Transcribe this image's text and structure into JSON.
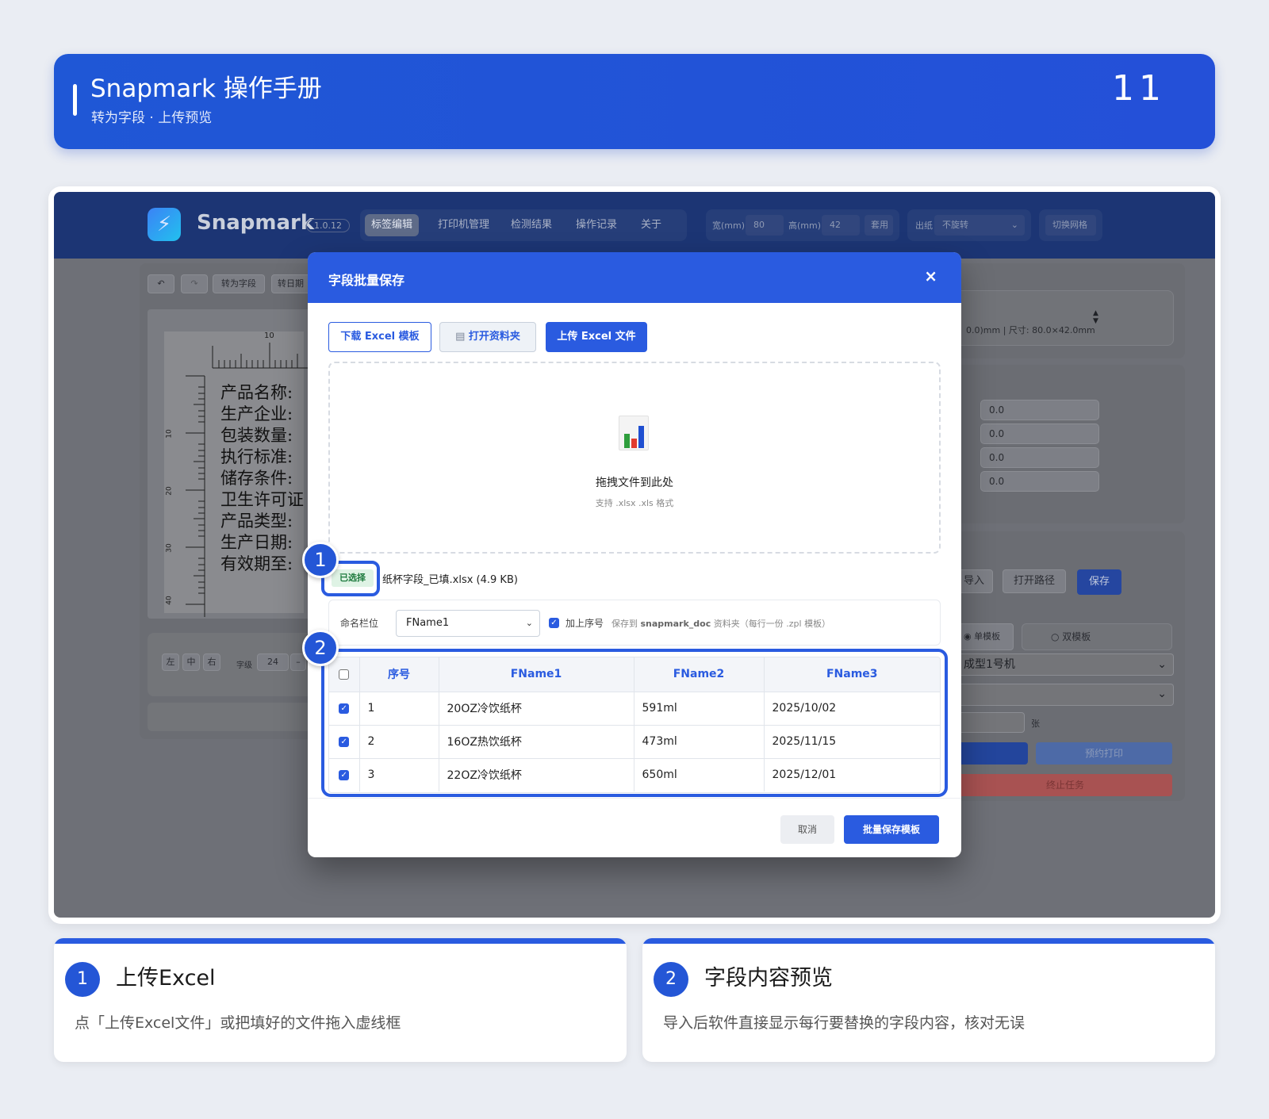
{
  "header": {
    "title": "Snapmark 操作手册",
    "subtitle": "转为字段 · 上传预览",
    "page_number": "11"
  },
  "app": {
    "brand": "Snapmark",
    "version": "1.0.12",
    "nav": [
      "标签编辑",
      "打印机管理",
      "检测结果",
      "操作记录",
      "关于"
    ],
    "width_label": "宽(mm)",
    "width_value": "80",
    "height_label": "高(mm)",
    "height_value": "42",
    "apply_label": "套用",
    "paper_label": "出纸",
    "paper_value": "不旋转",
    "grid_label": "切换网格",
    "toolbar": {
      "to_field": "转为字段",
      "to_date": "转日期"
    },
    "ruler_top": "10",
    "ruler_left": [
      "10",
      "20",
      "30",
      "40"
    ],
    "label_lines": [
      "产品名称:",
      "生产企业:",
      "包装数量:",
      "执行标准:",
      "储存条件:",
      "卫生许可证",
      "产品类型:",
      "生产日期:",
      "有效期至:"
    ],
    "align": [
      "左",
      "中",
      "右"
    ],
    "font_size_label": "字级",
    "font_size_value": "24",
    "minus_label": "–",
    "right_info": "0.0)mm | 尺寸: 80.0×42.0mm",
    "offset_values": [
      "0.0",
      "0.0",
      "0.0",
      "0.0"
    ],
    "import_label": "导入",
    "open_path": "打开路径",
    "save": "保存",
    "single_template": "单模板",
    "double_template": "双模板",
    "printer_select": "成型1号机",
    "sheet_unit": "张",
    "schedule_print": "预约打印",
    "stop_task": "终止任务"
  },
  "modal": {
    "title": "字段批量保存",
    "close": "×",
    "download_btn": "下载 Excel 模板",
    "open_folder_btn": "打开资料夹",
    "upload_btn": "上传 Excel 文件",
    "drop_text": "拖拽文件到此处",
    "drop_hint": "支持 .xlsx .xls 格式",
    "selected_badge": "已选择",
    "file_name": "纸杯字段_已填.xlsx (4.9 KB)",
    "name_field_label": "命名栏位",
    "name_field_value": "FName1",
    "add_seq_label": "加上序号",
    "save_hint_prefix": "保存到",
    "save_hint_folder": "snapmark_doc",
    "save_hint_suffix": "资料夹（每行一份 .zpl 模板）",
    "columns": [
      "序号",
      "FName1",
      "FName2",
      "FName3"
    ],
    "rows": [
      {
        "seq": "1",
        "f1": "20OZ冷饮纸杯",
        "f2": "591ml",
        "f3": "2025/10/02"
      },
      {
        "seq": "2",
        "f1": "16OZ热饮纸杯",
        "f2": "473ml",
        "f3": "2025/11/15"
      },
      {
        "seq": "3",
        "f1": "22OZ冷饮纸杯",
        "f2": "650ml",
        "f3": "2025/12/01"
      }
    ],
    "cancel": "取消",
    "batch_save": "批量保存模板"
  },
  "annotations": {
    "n1": "1",
    "n2": "2"
  },
  "cards": [
    {
      "num": "1",
      "title": "上传Excel",
      "desc": "点「上传Excel文件」或把填好的文件拖入虚线框"
    },
    {
      "num": "2",
      "title": "字段内容预览",
      "desc": "导入后软件直接显示每行要替换的字段内容，核对无误"
    }
  ],
  "colors": {
    "accent": "#2a5be0",
    "header": "#1f57d6",
    "success_bg": "#dff3e5"
  }
}
